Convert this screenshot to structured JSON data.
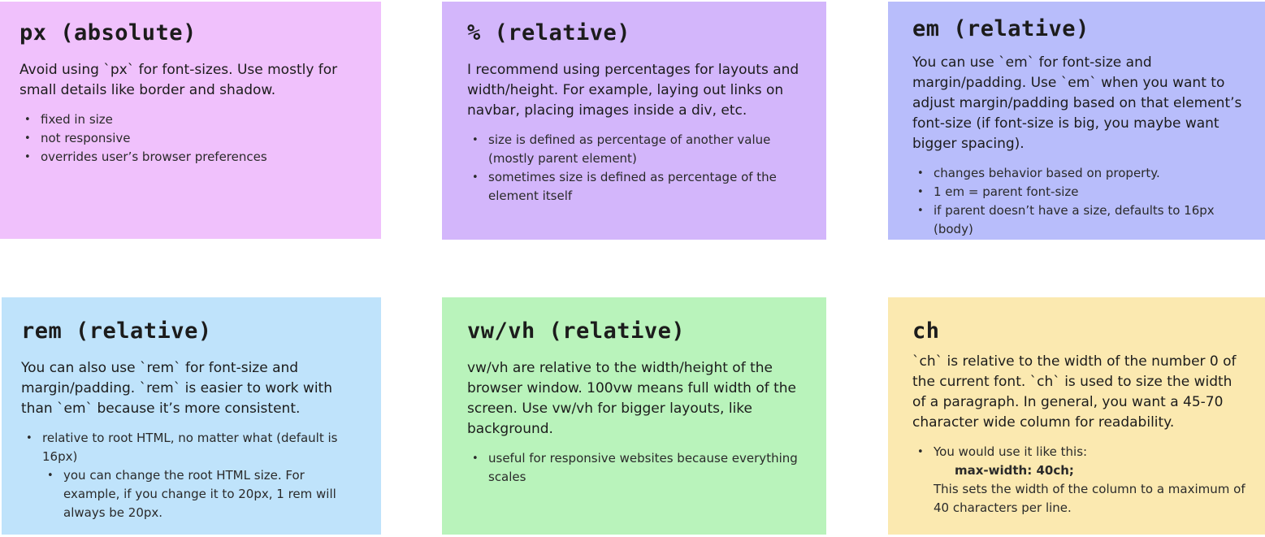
{
  "cards": [
    {
      "title": "px (absolute)",
      "color": "#f0c1fc",
      "description": "Avoid using `px` for font-sizes. Use mostly for small details like border and shadow.",
      "bullets": [
        "fixed in size",
        "not responsive",
        "overrides user’s browser preferences"
      ]
    },
    {
      "title": "% (relative)",
      "color": "#d3b6fb",
      "description": "I recommend using percentages for layouts and width/height. For example, laying out links on navbar, placing images inside a div, etc.",
      "bullets": [
        "size is defined as percentage of another value (mostly parent element)",
        "sometimes size is defined as percentage of the element itself"
      ]
    },
    {
      "title": "em (relative)",
      "color": "#b8bdfb",
      "description": "You can use `em` for font-size and margin/padding. Use `em` when you want to adjust margin/padding based on that element’s font-size (if font-size is big, you maybe want bigger spacing).",
      "bullets": [
        "changes behavior based on property.",
        "1 em = parent font-size",
        "if parent doesn’t have a size, defaults to 16px (body)"
      ]
    },
    {
      "title": "rem (relative)",
      "color": "#bfe3fb",
      "description": "You can also use `rem` for font-size and margin/padding. `rem` is easier to work with than `em` because it’s more consistent.",
      "bullets": [
        "relative to root HTML, no matter what (default is 16px)"
      ],
      "sub_bullets": [
        "you can change the root HTML size. For example, if you change it to 20px, 1 rem will always be 20px."
      ]
    },
    {
      "title": "vw/vh (relative)",
      "color": "#b9f3bb",
      "description": "vw/vh are relative to the width/height of the browser window. 100vw means full width of the screen. Use vw/vh for bigger layouts, like background.",
      "bullets": [
        "useful for responsive websites because everything scales"
      ]
    },
    {
      "title": "ch",
      "color": "#fbe9b0",
      "description": "`ch` is relative to the width of the number 0 of the current font. `ch` is used to size the width of a paragraph. In general, you want a 45-70 character wide column for readability.",
      "bullet_intro": "You would use it like this:",
      "bullet_code": "max-width: 40ch;",
      "bullet_note": "This sets the width of the column to a maximum of 40 characters per line."
    }
  ]
}
